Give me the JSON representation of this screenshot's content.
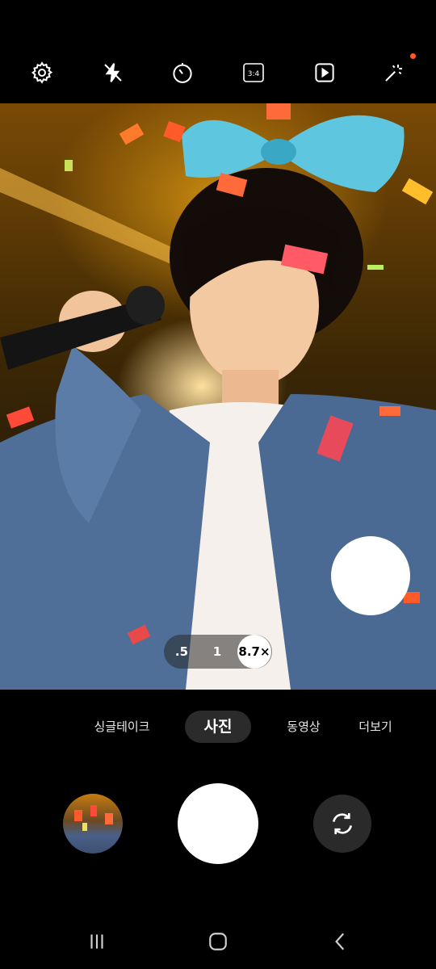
{
  "top_bar": {
    "icons": [
      "gear-icon",
      "flash-off-icon",
      "timer-icon",
      "aspect-ratio-icon",
      "motion-photo-icon",
      "filter-effects-icon"
    ],
    "aspect_ratio_label": "3:4",
    "notification_color": "#ff5a2a"
  },
  "zoom": {
    "options": [
      ".5",
      "1",
      "8.7×"
    ],
    "selected": "8.7×"
  },
  "modes": {
    "items": [
      "싱글테이크",
      "사진",
      "동영상",
      "더보기"
    ],
    "active": "사진"
  },
  "bottom_controls": {
    "gallery_thumbnail": "gallery-thumbnail",
    "shutter": "shutter-button",
    "switch_camera_icon": "camera-switch-icon"
  },
  "navbar": {
    "icons": [
      "recent-apps-icon",
      "home-icon",
      "back-icon"
    ]
  }
}
